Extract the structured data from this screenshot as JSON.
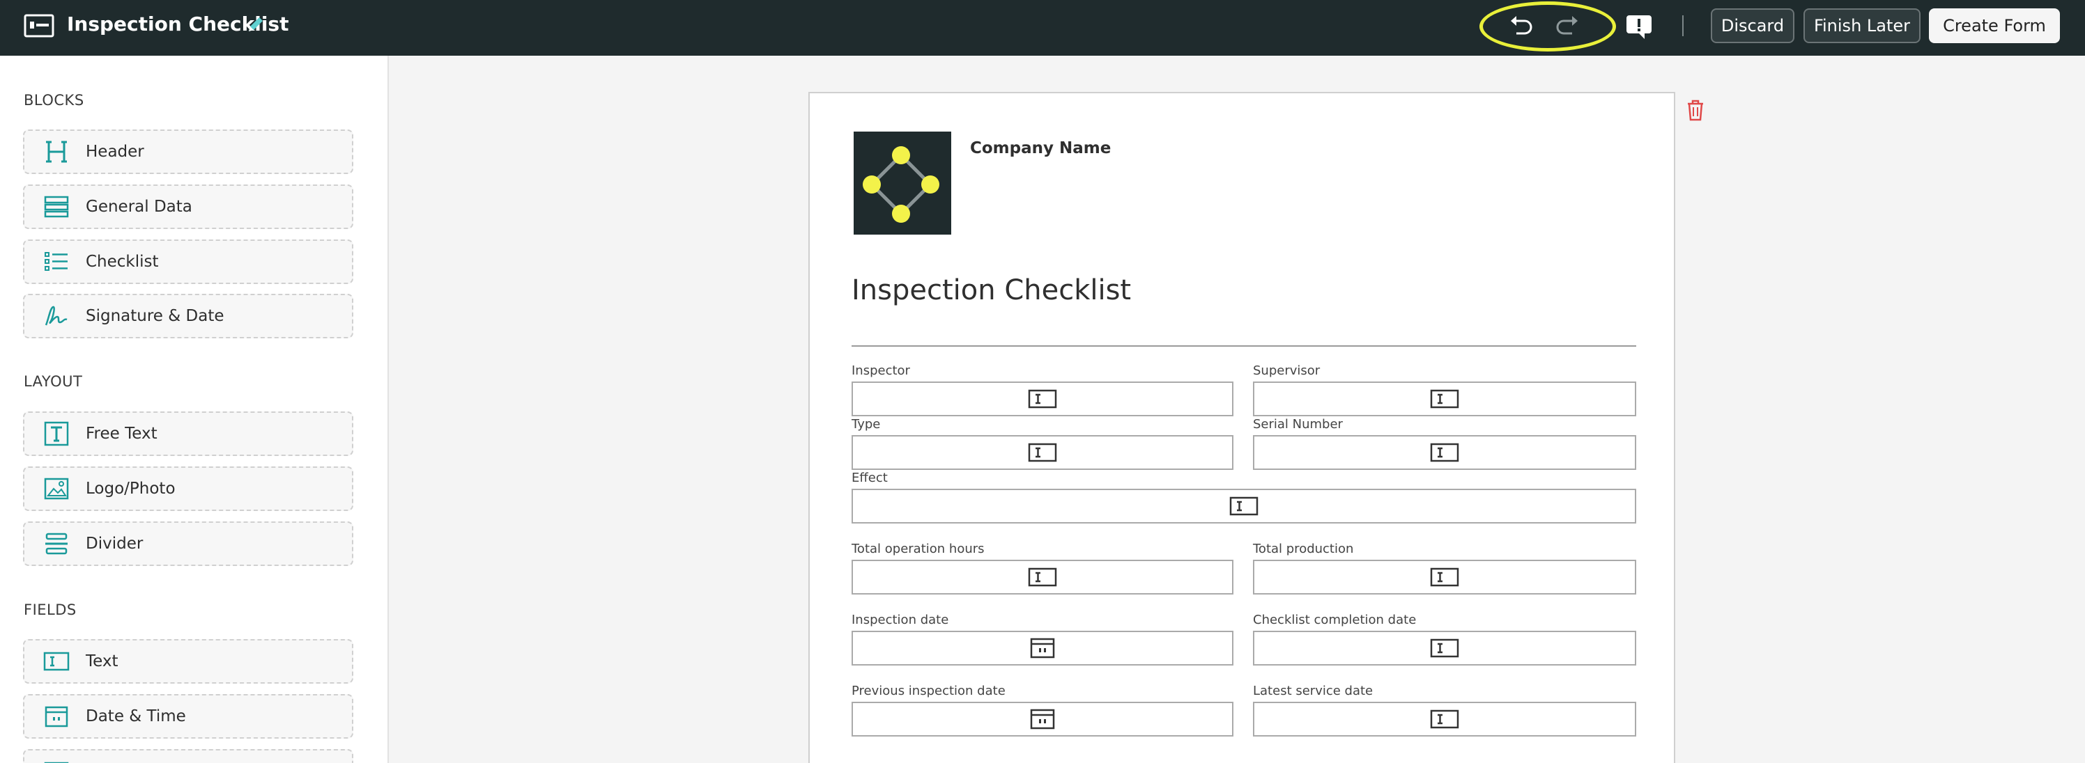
{
  "header": {
    "title": "Inspection Checklist",
    "discard_label": "Discard",
    "finish_later_label": "Finish Later",
    "create_form_label": "Create Form",
    "highlight_color": "#e9f03a"
  },
  "sidebar": {
    "sections": [
      {
        "title": "BLOCKS",
        "items": [
          {
            "label": "Header",
            "icon": "header-icon"
          },
          {
            "label": "General Data",
            "icon": "general-data-icon"
          },
          {
            "label": "Checklist",
            "icon": "checklist-icon"
          },
          {
            "label": "Signature & Date",
            "icon": "signature-icon"
          }
        ]
      },
      {
        "title": "LAYOUT",
        "items": [
          {
            "label": "Free Text",
            "icon": "free-text-icon"
          },
          {
            "label": "Logo/Photo",
            "icon": "image-icon"
          },
          {
            "label": "Divider",
            "icon": "divider-icon"
          }
        ]
      },
      {
        "title": "FIELDS",
        "items": [
          {
            "label": "Text",
            "icon": "text-field-icon"
          },
          {
            "label": "Date & Time",
            "icon": "calendar-icon"
          }
        ]
      }
    ]
  },
  "form": {
    "company_name": "Company Name",
    "title": "Inspection Checklist",
    "fields": [
      {
        "label": "Inspector",
        "kind": "text"
      },
      {
        "label": "Supervisor",
        "kind": "text"
      },
      {
        "label": "Type",
        "kind": "text"
      },
      {
        "label": "Serial Number",
        "kind": "text"
      },
      {
        "label": "Effect",
        "kind": "text"
      },
      {
        "label": "Total operation hours",
        "kind": "text"
      },
      {
        "label": "Total production",
        "kind": "text"
      },
      {
        "label": "Inspection date",
        "kind": "date"
      },
      {
        "label": "Checklist completion date",
        "kind": "text"
      },
      {
        "label": "Previous inspection date",
        "kind": "date"
      },
      {
        "label": "Latest service date",
        "kind": "text"
      }
    ]
  },
  "colors": {
    "topbar": "#1f2b2d",
    "accent_teal": "#1a9a9a",
    "logo_yellow": "#f3f24a",
    "trash_red": "#e04848"
  }
}
